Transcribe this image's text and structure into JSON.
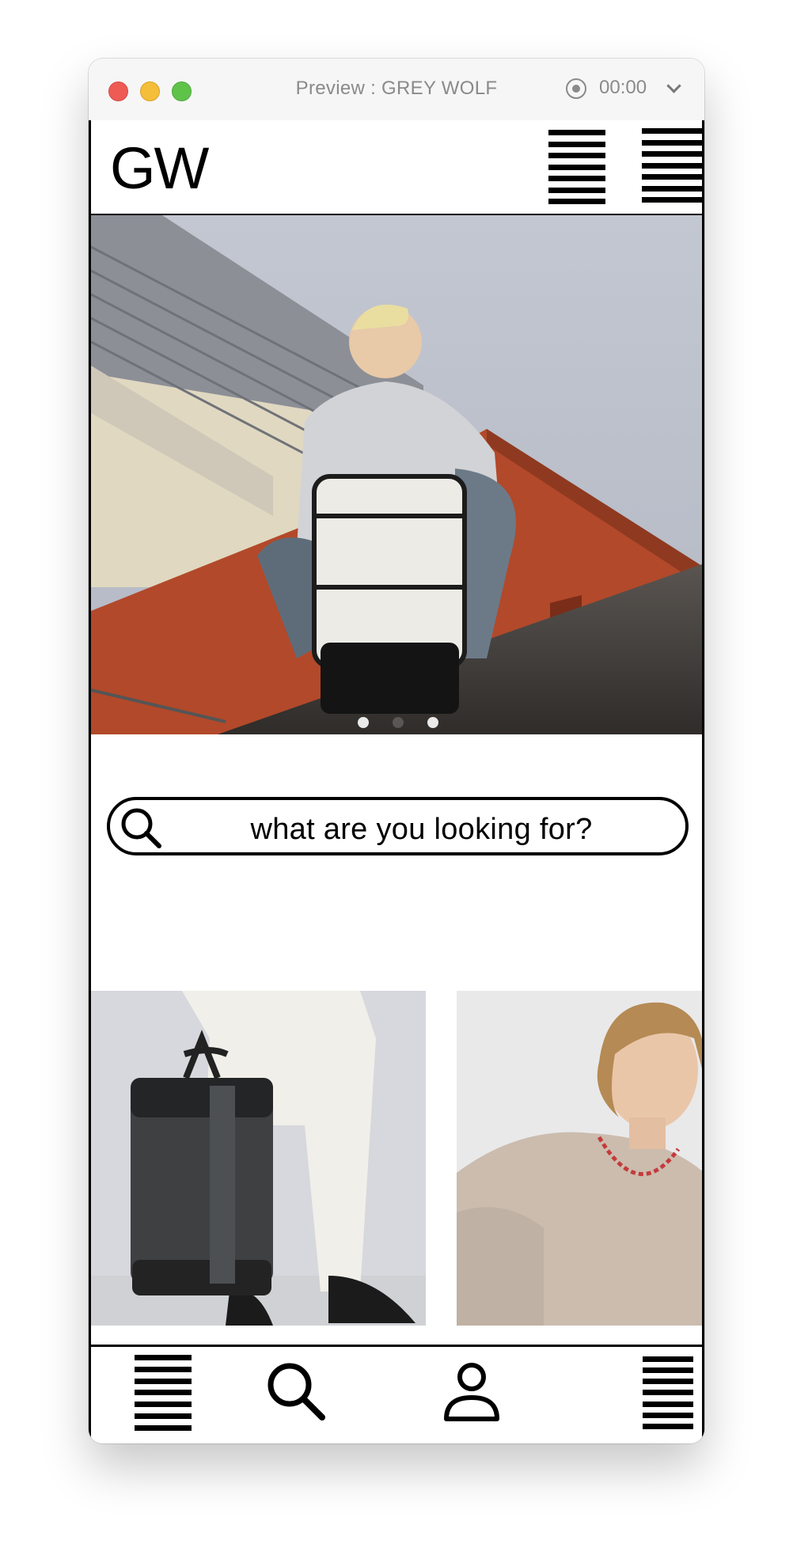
{
  "window": {
    "title": "Preview : GREY WOLF",
    "record_time": "00:00"
  },
  "header": {
    "logo": "GW"
  },
  "hero": {
    "slide_count": 3,
    "active_slide": 1
  },
  "search": {
    "placeholder": "what are you looking for?"
  },
  "colors": {
    "accent": "#e40000",
    "text": "#000000",
    "titlebar_text": "#8a8a8a"
  },
  "icons": {
    "header_menu": "hamburger-menu-icon",
    "header_menu_2": "hamburger-menu-icon",
    "search": "search-icon",
    "nav_menu": "hamburger-menu-icon",
    "nav_search": "search-icon",
    "nav_account": "user-icon",
    "nav_more": "hamburger-menu-icon"
  }
}
